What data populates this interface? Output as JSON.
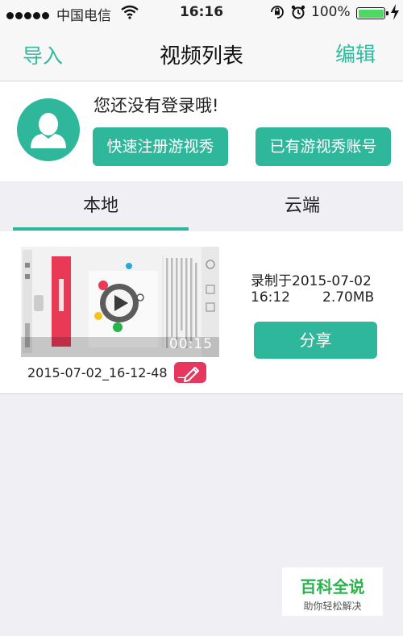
{
  "status_bar": {
    "carrier": "中国电信",
    "time": "16:16",
    "battery_percent": "100%",
    "battery_level": 1.0,
    "icons": [
      "signal-dots-icon",
      "wifi-icon",
      "orientation-lock-icon",
      "alarm-icon",
      "battery-icon",
      "charging-bolt-icon"
    ]
  },
  "nav": {
    "left_label": "导入",
    "title": "视频列表",
    "right_label": "编辑"
  },
  "login": {
    "message": "您还没有登录哦!",
    "register_button": "快速注册游视秀",
    "existing_account_button": "已有游视秀账号"
  },
  "tabs": [
    {
      "label": "本地",
      "selected": true
    },
    {
      "label": "云端",
      "selected": false
    }
  ],
  "videos": [
    {
      "duration": "00:15",
      "filename": "2015-07-02_16-12-48",
      "recorded_line1": "录制于2015-07-02",
      "recorded_time": "16:12",
      "file_size": "2.70MB",
      "share_button": "分享",
      "edit_tag_label": "_"
    }
  ],
  "watermark": {
    "title": "百科全说",
    "subtitle": "助你轻松解决"
  },
  "colors": {
    "accent": "#2fb79c",
    "edit_tag": "#e8375f",
    "page_bg": "#efeff4",
    "watermark_green": "#2ab24c"
  }
}
